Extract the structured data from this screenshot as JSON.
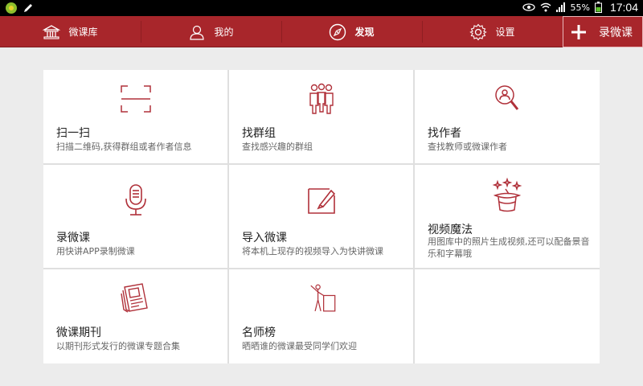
{
  "status": {
    "battery": "55%",
    "time": "17:04"
  },
  "nav": {
    "items": [
      {
        "label": "微课库",
        "icon": "library-icon"
      },
      {
        "label": "我的",
        "icon": "user-icon"
      },
      {
        "label": "发现",
        "icon": "compass-icon",
        "active": true
      },
      {
        "label": "设置",
        "icon": "gear-icon"
      }
    ],
    "record_label": "录微课"
  },
  "grid": {
    "cells": [
      {
        "title": "扫一扫",
        "desc": "扫描二维码,获得群组或者作者信息",
        "icon": "scan-icon"
      },
      {
        "title": "找群组",
        "desc": "查找感兴趣的群组",
        "icon": "group-icon"
      },
      {
        "title": "找作者",
        "desc": "查找教师或微课作者",
        "icon": "author-search-icon"
      },
      {
        "title": "录微课",
        "desc": "用快讲APP录制微课",
        "icon": "microphone-icon"
      },
      {
        "title": "导入微课",
        "desc": "将本机上现存的视频导入为快讲微课",
        "icon": "import-icon"
      },
      {
        "title": "视频魔法",
        "desc": "用图库中的照片生成视频,还可以配备景音乐和字幕哦",
        "icon": "magic-hat-icon"
      },
      {
        "title": "微课期刊",
        "desc": "以期刊形式发行的微课专题合集",
        "icon": "magazine-icon"
      },
      {
        "title": "名师榜",
        "desc": "晒晒谁的微课最受同学们欢迎",
        "icon": "podium-icon"
      }
    ]
  },
  "colors": {
    "accent": "#a8262b",
    "icon_stroke": "#b0313a"
  }
}
